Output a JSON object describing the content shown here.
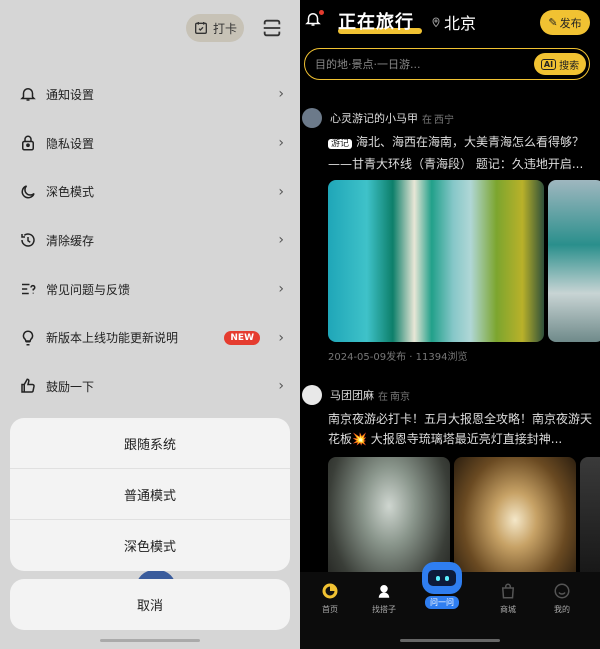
{
  "left": {
    "checkin_label": "打卡",
    "settings": [
      {
        "label": "通知设置",
        "icon": "bell-icon"
      },
      {
        "label": "隐私设置",
        "icon": "lock-icon"
      },
      {
        "label": "深色模式",
        "icon": "moon-icon"
      },
      {
        "label": "清除缓存",
        "icon": "clock-clear-icon"
      },
      {
        "label": "常见问题与反馈",
        "icon": "faq-icon"
      },
      {
        "label": "新版本上线功能更新说明",
        "icon": "bulb-icon",
        "badge": "NEW"
      },
      {
        "label": "鼓励一下",
        "icon": "thumb-up-icon"
      }
    ],
    "sheet_options": [
      "跟随系统",
      "普通模式",
      "深色模式"
    ],
    "cancel_label": "取消"
  },
  "right": {
    "title": "正在旅行",
    "location": "北京",
    "publish_label": "发布",
    "search": {
      "placeholder": "目的地·景点·一日游...",
      "ai_label": "AI",
      "button_label": "搜索"
    },
    "posts": [
      {
        "author": "心灵游记的小马甲",
        "location_prefix": "在",
        "location": "西宁",
        "tag": "游记",
        "text": "海北、海西在海南，大美青海怎么看得够？——甘青大环线（青海段） 题记：久违地开启...",
        "meta": "2024-05-09发布 · 11394浏览"
      },
      {
        "author": "马团团麻",
        "location_prefix": "在",
        "location": "南京",
        "tag": "",
        "text": "南京夜游必打卡！五月大报恩全攻略！南京夜游天花板💥 大报恩寺琉璃塔最近亮灯直接封神...",
        "meta": ""
      }
    ],
    "tabs": [
      {
        "label": "首页",
        "icon": "home-icon"
      },
      {
        "label": "找搭子",
        "icon": "buddy-icon"
      },
      {
        "label": "问一问",
        "icon": "ai-bot-icon"
      },
      {
        "label": "商城",
        "icon": "shop-icon"
      },
      {
        "label": "我的",
        "icon": "profile-icon"
      }
    ]
  },
  "colors": {
    "accent": "#f1c232",
    "badge_red": "#e53c2f",
    "bot_blue": "#2f7ef0"
  }
}
